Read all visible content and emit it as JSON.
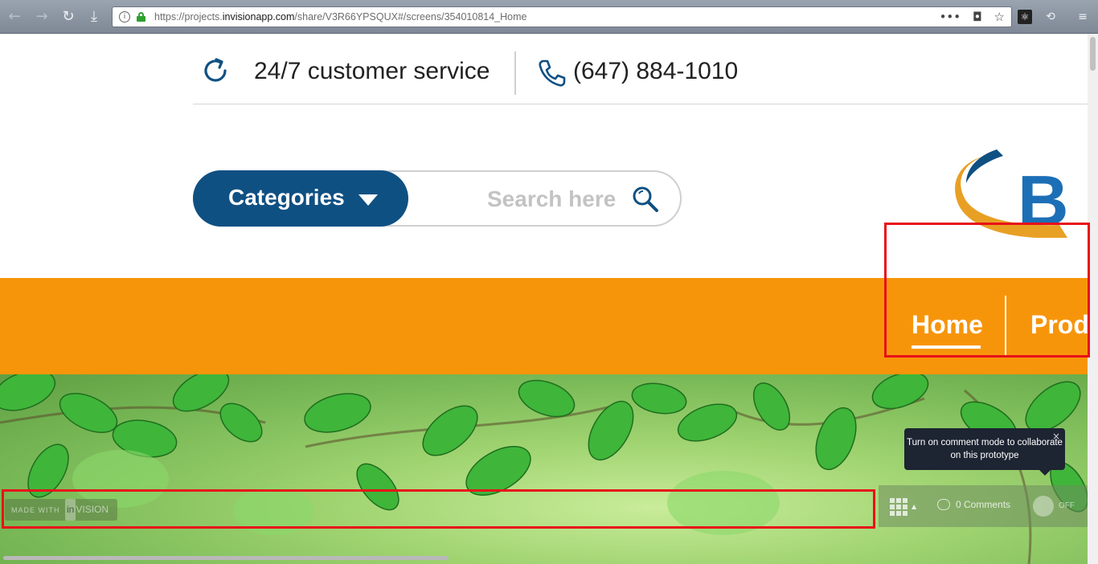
{
  "browser": {
    "url_prefix": "https://projects.",
    "url_domain": "invisionapp.com",
    "url_path": "/share/V3R66YPSQUX#/screens/354010814_Home",
    "menu_glyph": "≡"
  },
  "header": {
    "service_text": "24/7 customer service",
    "phone_text": "(647) 884-1010"
  },
  "search": {
    "categories_label": "Categories",
    "placeholder": "Search here"
  },
  "nav": {
    "items": [
      {
        "label": "Home",
        "active": true
      },
      {
        "label": "Prod"
      }
    ]
  },
  "logo": {
    "letters": "B"
  },
  "invision": {
    "made_with": "MADE WITH",
    "brand_in": "in",
    "brand_vision": "VISION",
    "tooltip": "Turn on comment mode to collaborate on this prototype",
    "tooltip_close": "×",
    "comments": "0 Comments",
    "toggle_state": "OFF"
  },
  "colors": {
    "accent_orange": "#f7950a",
    "brand_blue": "#0f5082",
    "highlight_red": "#e8101a"
  }
}
